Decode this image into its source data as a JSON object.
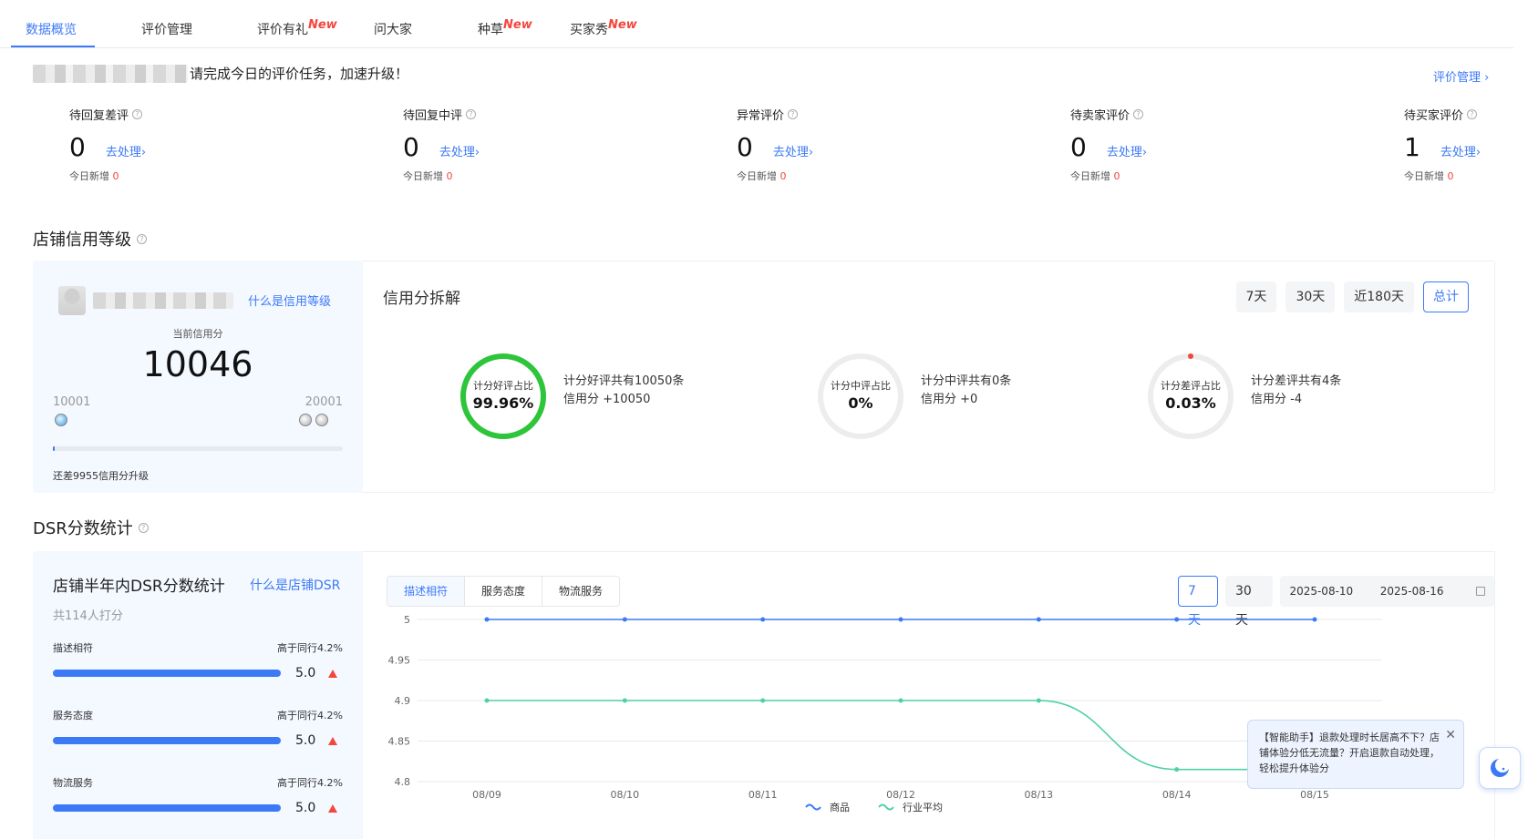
{
  "tabs": [
    {
      "label": "数据概览",
      "badge": ""
    },
    {
      "label": "评价管理",
      "badge": ""
    },
    {
      "label": "评价有礼",
      "badge": "New"
    },
    {
      "label": "问大家",
      "badge": ""
    },
    {
      "label": "种草",
      "badge": "New"
    },
    {
      "label": "买家秀",
      "badge": "New"
    }
  ],
  "notice": {
    "text": "请完成今日的评价任务，加速升级！",
    "link": "评价管理 ›"
  },
  "stats": [
    {
      "title": "待回复差评",
      "value": "0",
      "link": "去处理›",
      "sub_label": "今日新增",
      "sub_value": "0"
    },
    {
      "title": "待回复中评",
      "value": "0",
      "link": "去处理›",
      "sub_label": "今日新增",
      "sub_value": "0"
    },
    {
      "title": "异常评价",
      "value": "0",
      "link": "去处理›",
      "sub_label": "今日新增",
      "sub_value": "0"
    },
    {
      "title": "待卖家评价",
      "value": "0",
      "link": "去处理›",
      "sub_label": "今日新增",
      "sub_value": "0"
    },
    {
      "title": "待买家评价",
      "value": "1",
      "link": "去处理›",
      "sub_label": "今日新增",
      "sub_value": "0"
    }
  ],
  "credit": {
    "section_title": "店铺信用等级",
    "what_link": "什么是信用等级",
    "current_label": "当前信用分",
    "current_score": "10046",
    "level_low": "10001",
    "level_high": "20001",
    "progress_fraction": 0.005,
    "remaining_text": "还差9955信用分升级",
    "breakdown_title": "信用分拆解",
    "periods": [
      "7天",
      "30天",
      "近180天",
      "总计"
    ],
    "active_period": "总计",
    "rings": [
      {
        "label": "计分好评占比",
        "value": "99.96%",
        "fraction": 0.9996,
        "color": "#2dc53a",
        "desc1": "计分好评共有10050条",
        "desc2": "信用分 +10050"
      },
      {
        "label": "计分中评占比",
        "value": "0%",
        "fraction": 0.0,
        "color": "#f5463c",
        "desc1": "计分中评共有0条",
        "desc2": "信用分 +0"
      },
      {
        "label": "计分差评占比",
        "value": "0.03%",
        "fraction": 0.0003,
        "color": "#f5463c",
        "desc1": "计分差评共有4条",
        "desc2": "信用分 -4"
      }
    ]
  },
  "dsr": {
    "section_title": "DSR分数统计",
    "panel_title": "店铺半年内DSR分数统计",
    "what_link": "什么是店铺DSR",
    "count_text": "共114人打分",
    "rows": [
      {
        "name": "描述相符",
        "compare": "高于同行4.2%",
        "score": "5.0"
      },
      {
        "name": "服务态度",
        "compare": "高于同行4.2%",
        "score": "5.0"
      },
      {
        "name": "物流服务",
        "compare": "高于同行4.2%",
        "score": "5.0"
      }
    ],
    "segments": [
      "描述相符",
      "服务态度",
      "物流服务"
    ],
    "active_segment": "描述相符",
    "periods": [
      "7天",
      "30天"
    ],
    "active_period": "7天",
    "date_start": "2025-08-10",
    "date_end": "2025-08-16"
  },
  "chart_data": {
    "type": "line",
    "x": [
      "08/09",
      "08/10",
      "08/11",
      "08/12",
      "08/13",
      "08/14",
      "08/15"
    ],
    "ylim": [
      4.8,
      5
    ],
    "yticks": [
      "5",
      "4.95",
      "4.9",
      "4.85",
      "4.8"
    ],
    "series": [
      {
        "name": "商品",
        "color": "#3c7af5",
        "values": [
          5,
          5,
          5,
          5,
          5,
          5,
          5
        ]
      },
      {
        "name": "行业平均",
        "color": "#4fd1a5",
        "values": [
          4.9,
          4.9,
          4.9,
          4.9,
          4.9,
          4.815,
          4.815
        ]
      }
    ],
    "legend_position": "bottom"
  },
  "tooltip": {
    "text": "【智能助手】退款处理时长居高不下？店铺体验分低无流量？开启退款自动处理，轻松提升体验分"
  },
  "colors": {
    "accent": "#3c7af5",
    "danger": "#f5463c",
    "good": "#2dc53a"
  }
}
